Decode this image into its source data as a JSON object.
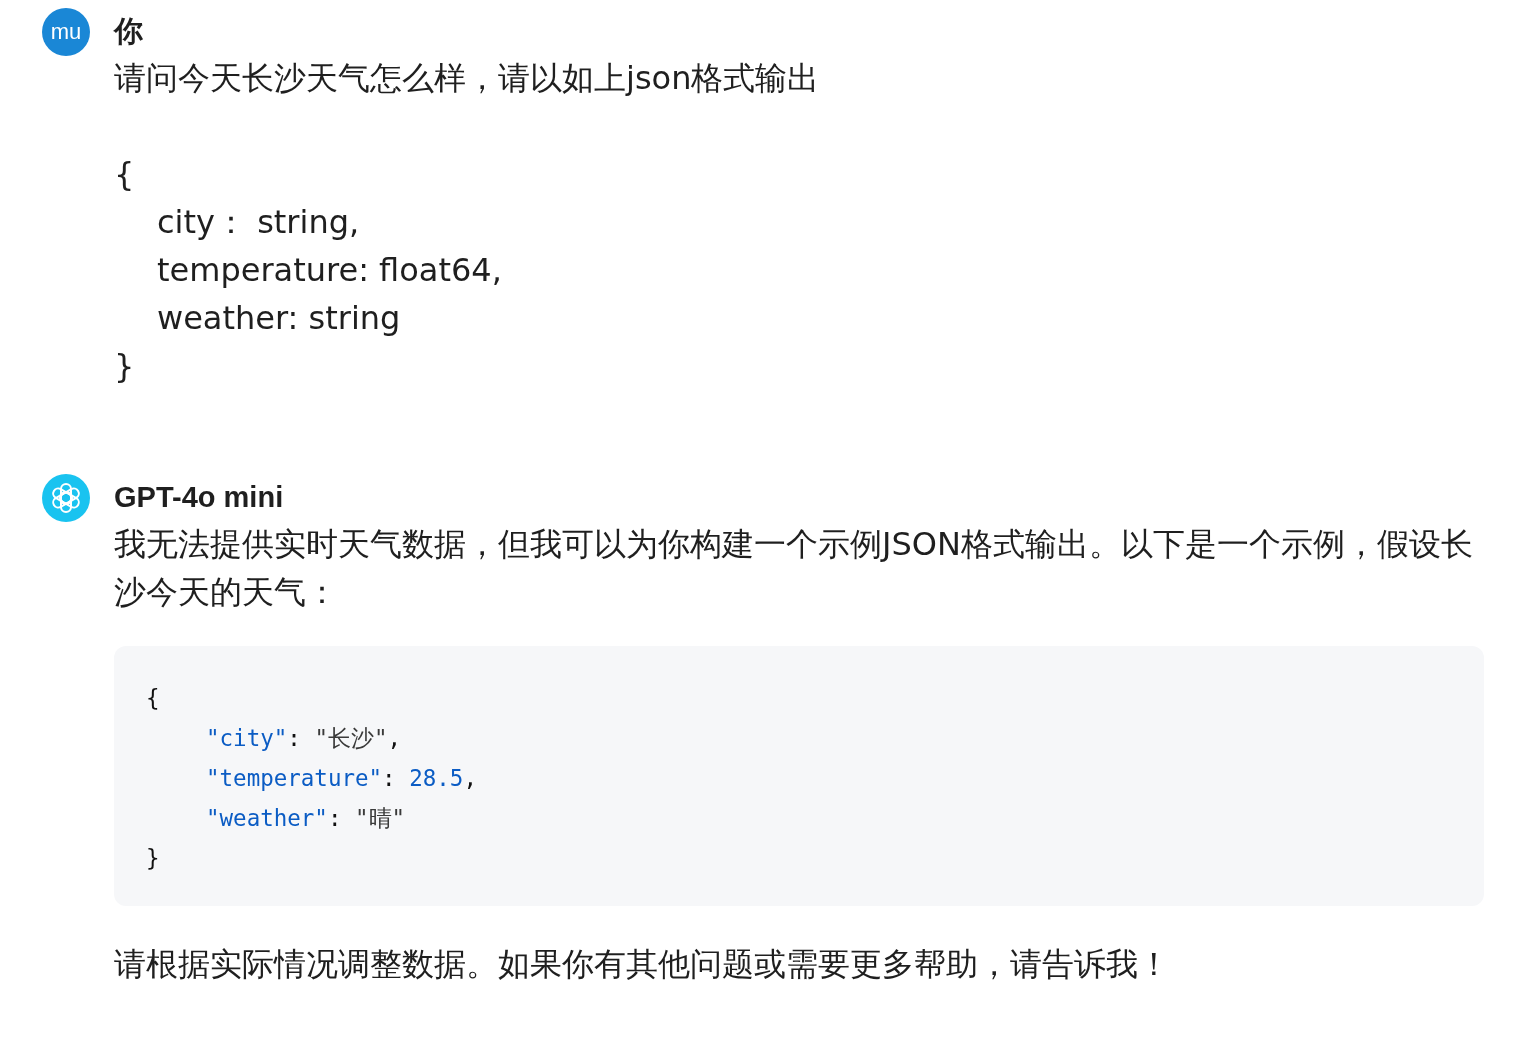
{
  "messages": [
    {
      "kind": "user",
      "avatar": "mu",
      "author": "你",
      "blocks": [
        {
          "lines": [
            {
              "text": "请问今天长沙天气怎么样，请以如上json格式输出"
            }
          ]
        },
        {
          "lines": [
            {
              "text": "{",
              "children": [
                {
                  "text": "city： string,"
                },
                {
                  "text": "temperature: float64,"
                },
                {
                  "text": "weather: string"
                }
              ]
            },
            {
              "text": "}"
            }
          ]
        }
      ]
    },
    {
      "kind": "assistant",
      "author": "GPT-4o mini",
      "intro": "我无法提供实时天气数据，但我可以为你构建一个示例JSON格式输出。以下是一个示例，假设长沙今天的天气：",
      "code": [
        {
          "tokens": [
            {
              "kind": "punct",
              "text": "{"
            }
          ],
          "children": [
            {
              "tokens": [
                {
                  "kind": "key",
                  "text": "\"city\""
                },
                {
                  "kind": "punct",
                  "text": ": "
                },
                {
                  "kind": "string",
                  "text": "\"长沙\""
                },
                {
                  "kind": "punct",
                  "text": ","
                }
              ]
            },
            {
              "tokens": [
                {
                  "kind": "key",
                  "text": "\"temperature\""
                },
                {
                  "kind": "punct",
                  "text": ": "
                },
                {
                  "kind": "number",
                  "text": "28.5"
                },
                {
                  "kind": "punct",
                  "text": ","
                }
              ]
            },
            {
              "tokens": [
                {
                  "kind": "key",
                  "text": "\"weather\""
                },
                {
                  "kind": "punct",
                  "text": ": "
                },
                {
                  "kind": "string",
                  "text": "\"晴\""
                }
              ]
            }
          ]
        },
        {
          "tokens": [
            {
              "kind": "punct",
              "text": "}"
            }
          ]
        }
      ],
      "outro": "请根据实际情况调整数据。如果你有其他问题或需要更多帮助，请告诉我！"
    }
  ]
}
